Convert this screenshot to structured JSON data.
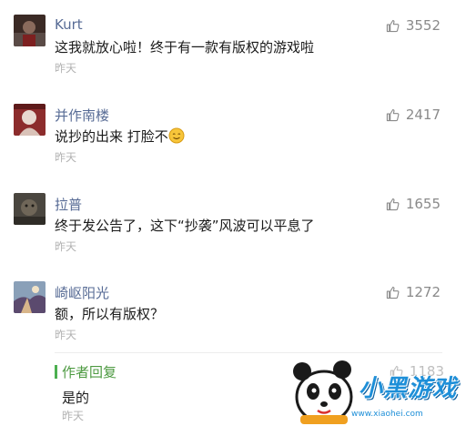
{
  "comments": [
    {
      "name": "Kurt",
      "text": "这我就放心啦！终于有一款有版权的游戏啦",
      "time": "昨天",
      "likes": "3552"
    },
    {
      "name": "并作南楼",
      "text": "说抄的出来 打脸不",
      "time": "昨天",
      "likes": "2417",
      "emoji": "smiling-face-icon"
    },
    {
      "name": "拉普",
      "text": "终于发公告了，这下“抄袭”风波可以平息了",
      "time": "昨天",
      "likes": "1655"
    },
    {
      "name": "崎岖阳光",
      "text": "额，所以有版权？",
      "time": "昨天",
      "likes": "1272"
    }
  ],
  "reply": {
    "author": "作者回复",
    "text": "是的",
    "time": "昨天",
    "likes": "1183"
  },
  "watermark": {
    "title": "小黑游戏",
    "url": "www.xiaohei.com"
  },
  "icons": {
    "like": "thumbs-up-icon"
  },
  "colors": {
    "name": "#576b95",
    "time": "#b2b2b2",
    "reply_accent": "#4caf50",
    "watermark": "#1e8fd8"
  }
}
